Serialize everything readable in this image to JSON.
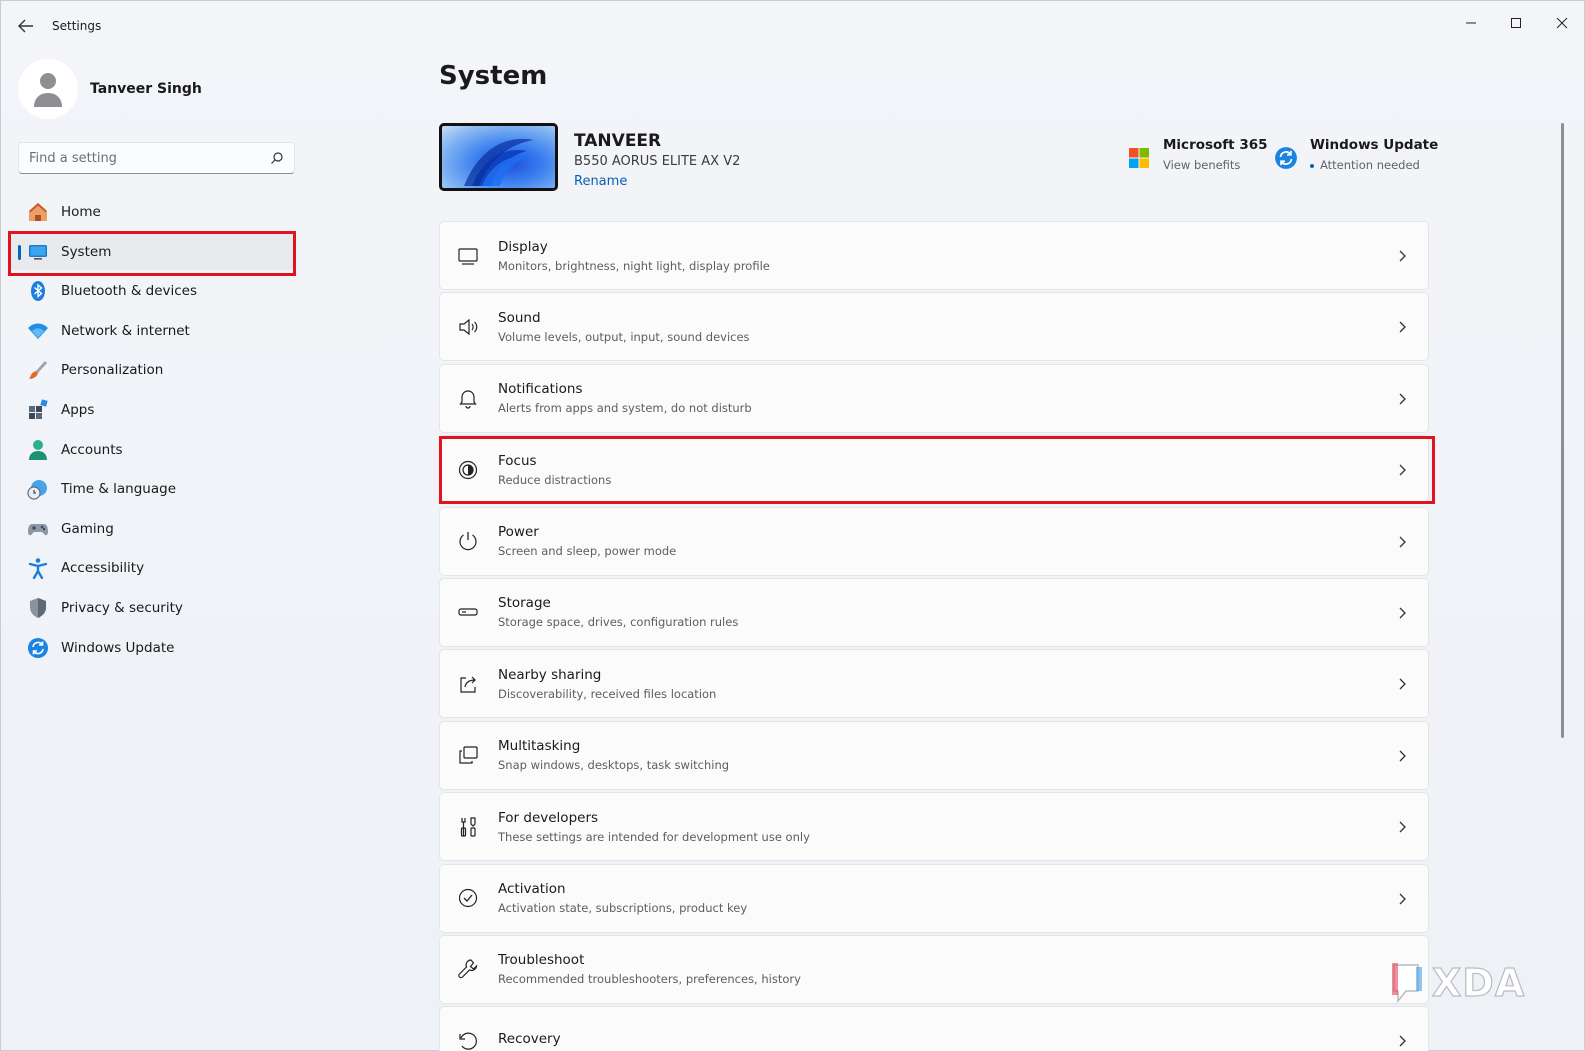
{
  "window": {
    "title": "Settings"
  },
  "user": {
    "name": "Tanveer Singh"
  },
  "search": {
    "placeholder": "Find a setting"
  },
  "sidebar": {
    "items": [
      {
        "label": "Home",
        "icon": "home-icon"
      },
      {
        "label": "System",
        "icon": "system-icon",
        "active": true
      },
      {
        "label": "Bluetooth & devices",
        "icon": "bluetooth-icon"
      },
      {
        "label": "Network & internet",
        "icon": "wifi-icon"
      },
      {
        "label": "Personalization",
        "icon": "brush-icon"
      },
      {
        "label": "Apps",
        "icon": "apps-icon"
      },
      {
        "label": "Accounts",
        "icon": "account-icon"
      },
      {
        "label": "Time & language",
        "icon": "clock-globe-icon"
      },
      {
        "label": "Gaming",
        "icon": "controller-icon"
      },
      {
        "label": "Accessibility",
        "icon": "accessibility-icon"
      },
      {
        "label": "Privacy & security",
        "icon": "shield-icon"
      },
      {
        "label": "Windows Update",
        "icon": "update-icon"
      }
    ]
  },
  "main": {
    "title": "System",
    "device": {
      "name": "TANVEER",
      "model": "B550 AORUS ELITE AX V2",
      "rename_label": "Rename"
    },
    "promos": [
      {
        "title": "Microsoft 365",
        "subtitle": "View benefits",
        "icon": "microsoft-logo-icon"
      },
      {
        "title": "Windows Update",
        "subtitle": "Attention needed",
        "icon": "update-icon"
      }
    ],
    "cards": [
      {
        "title": "Display",
        "subtitle": "Monitors, brightness, night light, display profile",
        "icon": "display-icon"
      },
      {
        "title": "Sound",
        "subtitle": "Volume levels, output, input, sound devices",
        "icon": "speaker-icon"
      },
      {
        "title": "Notifications",
        "subtitle": "Alerts from apps and system, do not disturb",
        "icon": "bell-icon"
      },
      {
        "title": "Focus",
        "subtitle": "Reduce distractions",
        "icon": "focus-icon"
      },
      {
        "title": "Power",
        "subtitle": "Screen and sleep, power mode",
        "icon": "power-icon"
      },
      {
        "title": "Storage",
        "subtitle": "Storage space, drives, configuration rules",
        "icon": "storage-icon"
      },
      {
        "title": "Nearby sharing",
        "subtitle": "Discoverability, received files location",
        "icon": "share-icon"
      },
      {
        "title": "Multitasking",
        "subtitle": "Snap windows, desktops, task switching",
        "icon": "multitasking-icon"
      },
      {
        "title": "For developers",
        "subtitle": "These settings are intended for development use only",
        "icon": "developer-tools-icon"
      },
      {
        "title": "Activation",
        "subtitle": "Activation state, subscriptions, product key",
        "icon": "checkmark-circle-icon"
      },
      {
        "title": "Troubleshoot",
        "subtitle": "Recommended troubleshooters, preferences, history",
        "icon": "wrench-icon"
      },
      {
        "title": "Recovery",
        "subtitle": "",
        "icon": "recovery-icon"
      }
    ]
  },
  "watermark": {
    "text": "XDA"
  },
  "colors": {
    "accent": "#0067c0",
    "highlight": "#e0141e",
    "link": "#0a5fb4"
  }
}
